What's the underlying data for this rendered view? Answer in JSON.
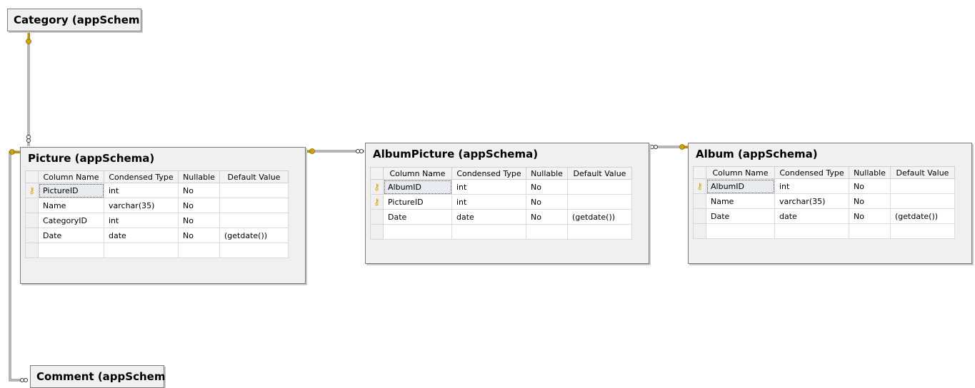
{
  "tables": {
    "category": {
      "title": "Category (appSchem"
    },
    "comment": {
      "title": "Comment (appSchem"
    },
    "picture": {
      "title": "Picture (appSchema)",
      "columns": [
        "Column Name",
        "Condensed Type",
        "Nullable",
        "Default Value"
      ],
      "rows": [
        {
          "key": true,
          "name": "PictureID",
          "type": "int",
          "nullable": "No",
          "default": ""
        },
        {
          "key": false,
          "name": "Name",
          "type": "varchar(35)",
          "nullable": "No",
          "default": ""
        },
        {
          "key": false,
          "name": "CategoryID",
          "type": "int",
          "nullable": "No",
          "default": ""
        },
        {
          "key": false,
          "name": "Date",
          "type": "date",
          "nullable": "No",
          "default": "(getdate())"
        }
      ]
    },
    "album_picture": {
      "title": "AlbumPicture (appSchema)",
      "columns": [
        "Column Name",
        "Condensed Type",
        "Nullable",
        "Default Value"
      ],
      "rows": [
        {
          "key": true,
          "name": "AlbumID",
          "type": "int",
          "nullable": "No",
          "default": ""
        },
        {
          "key": true,
          "name": "PictureID",
          "type": "int",
          "nullable": "No",
          "default": ""
        },
        {
          "key": false,
          "name": "Date",
          "type": "date",
          "nullable": "No",
          "default": "(getdate())"
        }
      ]
    },
    "album": {
      "title": "Album (appSchema)",
      "columns": [
        "Column Name",
        "Condensed Type",
        "Nullable",
        "Default Value"
      ],
      "rows": [
        {
          "key": true,
          "name": "AlbumID",
          "type": "int",
          "nullable": "No",
          "default": ""
        },
        {
          "key": false,
          "name": "Name",
          "type": "varchar(35)",
          "nullable": "No",
          "default": ""
        },
        {
          "key": false,
          "name": "Date",
          "type": "date",
          "nullable": "No",
          "default": "(getdate())"
        }
      ]
    }
  },
  "colors": {
    "key_gold": "#d4a200",
    "relationship_line": "#6e6e6e",
    "box_bg": "#f0f0f0"
  },
  "icons": {
    "primary_key": "key-icon",
    "one_end": "key-icon",
    "many_end": "infinity-icon"
  }
}
